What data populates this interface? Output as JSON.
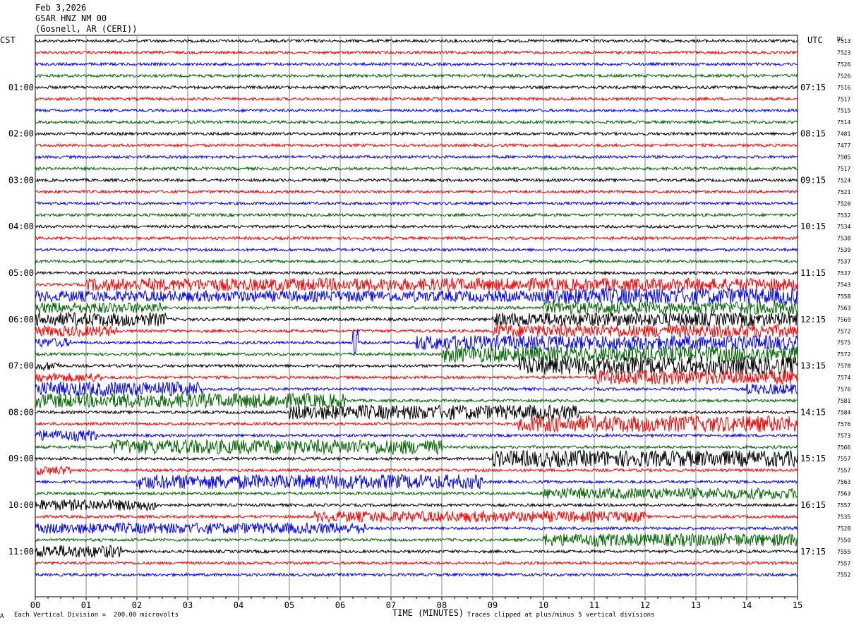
{
  "header": {
    "date": "Feb 3,2026",
    "station": "GSAR HNZ NM 00",
    "location": "(Gosnell, AR (CERI))"
  },
  "left_axis_title": "CST",
  "right_axis_title": "UTC",
  "dc_title": "DC",
  "footer": {
    "scale_note": "Each Vertical Division =  200.00 microvolts",
    "xlabel": "TIME (MINUTES)",
    "clip_note": "Traces clipped at plus/minus 5 vertical divisions",
    "corner_mark": "A"
  },
  "chart_data": {
    "type": "line",
    "title": "",
    "xlabel": "TIME (MINUTES)",
    "xlim": [
      0,
      15
    ],
    "x_ticks": [
      "00",
      "01",
      "02",
      "03",
      "04",
      "05",
      "06",
      "07",
      "08",
      "09",
      "10",
      "11",
      "12",
      "13",
      "14",
      "15"
    ],
    "trace_colors": [
      "#000000",
      "#ff0000",
      "#0000ff",
      "#006400"
    ],
    "rows_per_hour": 4,
    "left_time_labels": [
      "01:00",
      "02:00",
      "03:00",
      "04:00",
      "05:00",
      "06:00",
      "07:00",
      "08:00",
      "09:00",
      "10:00",
      "11:00"
    ],
    "right_time_labels": [
      "07:15",
      "08:15",
      "09:15",
      "10:15",
      "11:15",
      "12:15",
      "13:15",
      "14:15",
      "15:15",
      "16:15",
      "17:15"
    ],
    "dc_offsets": [
      7513,
      7523,
      7526,
      7526,
      7516,
      7517,
      7515,
      7514,
      7481,
      7477,
      7505,
      7517,
      7524,
      7521,
      7520,
      7532,
      7534,
      7538,
      7539,
      7537,
      7537,
      7543,
      7558,
      7563,
      7569,
      7572,
      7575,
      7572,
      7578,
      7574,
      7576,
      7581,
      7584,
      7576,
      7573,
      7566,
      7557,
      7557,
      7563,
      7563,
      7557,
      7535,
      7528,
      7550,
      7555,
      7557,
      7552
    ],
    "noise_bursts": [
      {
        "row": 21,
        "start_min": 1.0,
        "end_min": 15,
        "level": 0.7
      },
      {
        "row": 22,
        "start_min": 0,
        "end_min": 10.0,
        "level": 0.6
      },
      {
        "row": 22,
        "start_min": 10.0,
        "end_min": 15,
        "level": 0.9
      },
      {
        "row": 23,
        "start_min": 0,
        "end_min": 2.5,
        "level": 0.6
      },
      {
        "row": 23,
        "start_min": 10.0,
        "end_min": 15,
        "level": 0.7
      },
      {
        "row": 24,
        "start_min": 0,
        "end_min": 2.6,
        "level": 0.75
      },
      {
        "row": 24,
        "start_min": 9.0,
        "end_min": 15,
        "level": 0.75
      },
      {
        "row": 25,
        "start_min": 0,
        "end_min": 1.6,
        "level": 0.6
      },
      {
        "row": 25,
        "start_min": 9.0,
        "end_min": 15,
        "level": 0.7
      },
      {
        "row": 26,
        "start_min": 0,
        "end_min": 0.7,
        "level": 0.5
      },
      {
        "row": 26,
        "start_min": 7.5,
        "end_min": 15,
        "level": 0.8
      },
      {
        "row": 27,
        "start_min": 8.0,
        "end_min": 15,
        "level": 0.9
      },
      {
        "row": 28,
        "start_min": 0,
        "end_min": 0.5,
        "level": 0.5
      },
      {
        "row": 28,
        "start_min": 9.5,
        "end_min": 15,
        "level": 1.0
      },
      {
        "row": 29,
        "start_min": 0,
        "end_min": 1.3,
        "level": 0.5
      },
      {
        "row": 29,
        "start_min": 11.0,
        "end_min": 15,
        "level": 0.8
      },
      {
        "row": 30,
        "start_min": 0,
        "end_min": 3.3,
        "level": 0.8
      },
      {
        "row": 30,
        "start_min": 14.0,
        "end_min": 15,
        "level": 0.6
      },
      {
        "row": 31,
        "start_min": 0,
        "end_min": 6.1,
        "level": 0.8
      },
      {
        "row": 32,
        "start_min": 5.0,
        "end_min": 10.7,
        "level": 0.8
      },
      {
        "row": 33,
        "start_min": 9.5,
        "end_min": 15,
        "level": 0.9
      },
      {
        "row": 34,
        "start_min": 0,
        "end_min": 1.2,
        "level": 0.6
      },
      {
        "row": 35,
        "start_min": 1.5,
        "end_min": 8.0,
        "level": 0.8
      },
      {
        "row": 36,
        "start_min": 9.0,
        "end_min": 15,
        "level": 0.9
      },
      {
        "row": 37,
        "start_min": 0,
        "end_min": 0.7,
        "level": 0.5
      },
      {
        "row": 38,
        "start_min": 2.0,
        "end_min": 8.8,
        "level": 0.8
      },
      {
        "row": 39,
        "start_min": 10.0,
        "end_min": 15,
        "level": 0.6
      },
      {
        "row": 40,
        "start_min": 0,
        "end_min": 2.4,
        "level": 0.6
      },
      {
        "row": 41,
        "start_min": 5.5,
        "end_min": 12.0,
        "level": 0.6
      },
      {
        "row": 42,
        "start_min": 0,
        "end_min": 6.5,
        "level": 0.6
      },
      {
        "row": 43,
        "start_min": 10.0,
        "end_min": 15,
        "level": 0.7
      },
      {
        "row": 44,
        "start_min": 0,
        "end_min": 1.7,
        "level": 0.7
      }
    ],
    "spikes": [
      {
        "row": 26,
        "minute": 6.3,
        "amplitude": 2.5
      }
    ],
    "grid": true
  }
}
